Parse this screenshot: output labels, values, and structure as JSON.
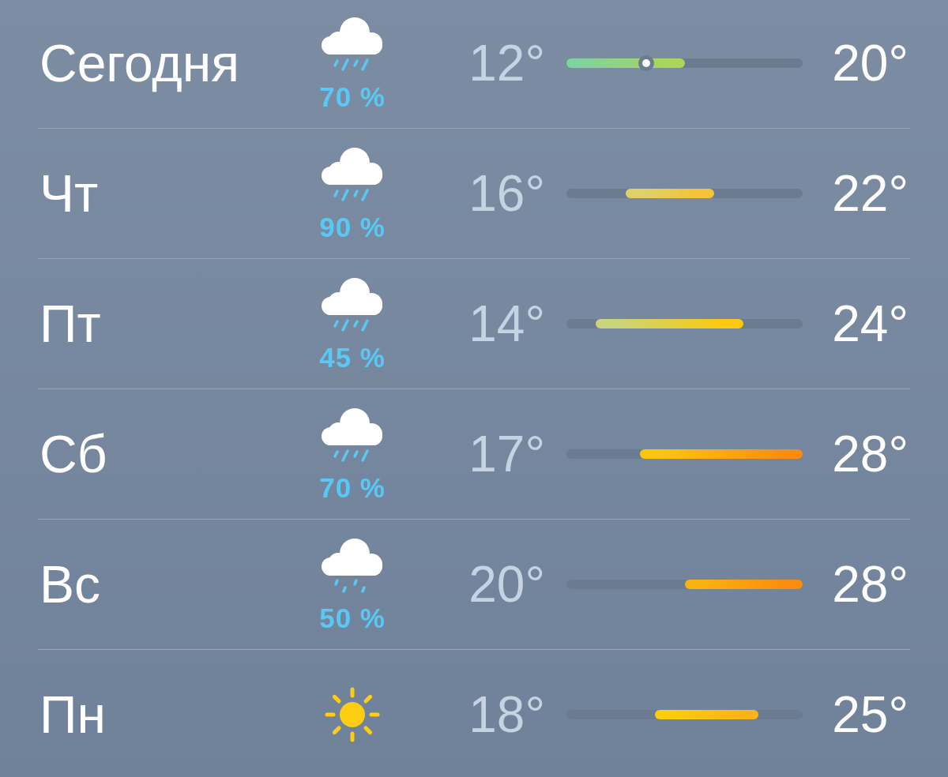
{
  "days": [
    {
      "day": "Сегодня",
      "kind": "rain",
      "precipitation": "70 %",
      "low": "12°",
      "high": "20°",
      "bar_gradient": [
        {
          "color": "#7fd39c"
        },
        {
          "color": "#aad65a"
        }
      ],
      "current": {
        "level": 0.338
      }
    },
    {
      "day": "Чт",
      "kind": "rain",
      "precipitation": "90 %",
      "low": "16°",
      "high": "22°",
      "bar_gradient": [
        {
          "color": "#e0d068"
        },
        {
          "color": "#f4c33a"
        }
      ]
    },
    {
      "day": "Пт",
      "kind": "rain",
      "precipitation": "45 %",
      "low": "14°",
      "high": "24°",
      "bar_gradient": [
        {
          "color": "#c8d57c"
        },
        {
          "color": "#fdc90a"
        }
      ]
    },
    {
      "day": "Сб",
      "kind": "rain",
      "precipitation": "70 %",
      "low": "17°",
      "high": "28°",
      "bar_gradient": [
        {
          "color": "#fdc50e"
        },
        {
          "color": "#fb8c10"
        }
      ]
    },
    {
      "day": "Вс",
      "kind": "drizzle",
      "precipitation": "50 %",
      "low": "20°",
      "high": "28°",
      "bar_gradient": [
        {
          "color": "#fcb20e"
        },
        {
          "color": "#fb8c0c"
        }
      ]
    },
    {
      "day": "Пн",
      "kind": "sun",
      "low": "18°",
      "high": "25°",
      "bar_gradient": [
        {
          "color": "#fdcd0c"
        },
        {
          "color": "#fbb418"
        }
      ]
    }
  ]
}
